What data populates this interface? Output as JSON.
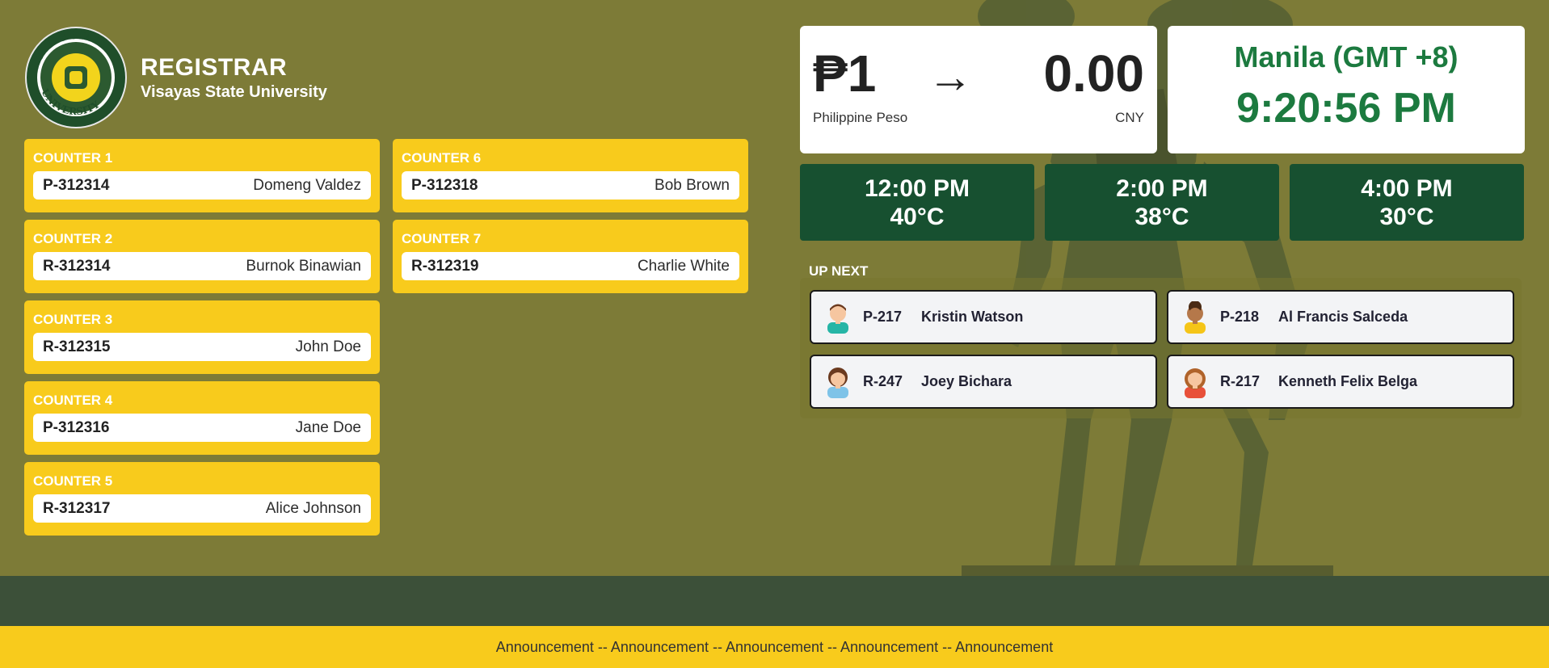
{
  "header": {
    "title": "REGISTRAR",
    "subtitle": "Visayas State University"
  },
  "counters": [
    {
      "label": "COUNTER 1",
      "ticket": "P-312314",
      "name": "Domeng Valdez"
    },
    {
      "label": "COUNTER 2",
      "ticket": "R-312314",
      "name": "Burnok Binawian"
    },
    {
      "label": "COUNTER 3",
      "ticket": "R-312315",
      "name": "John Doe"
    },
    {
      "label": "COUNTER 4",
      "ticket": "P-312316",
      "name": "Jane Doe"
    },
    {
      "label": "COUNTER 5",
      "ticket": "R-312317",
      "name": "Alice Johnson"
    },
    {
      "label": "COUNTER 6",
      "ticket": "P-312318",
      "name": "Bob Brown"
    },
    {
      "label": "COUNTER 7",
      "ticket": "R-312319",
      "name": "Charlie White"
    }
  ],
  "exchange": {
    "from_amount": "₱1",
    "arrow": "→",
    "to_amount": "0.00",
    "from_currency": "Philippine Peso",
    "to_currency": "CNY"
  },
  "clock": {
    "timezone": "Manila (GMT +8)",
    "time": "9:20:56 PM"
  },
  "forecast": [
    {
      "time": "12:00 PM",
      "temp": "40°C"
    },
    {
      "time": "2:00 PM",
      "temp": "38°C"
    },
    {
      "time": "4:00 PM",
      "temp": "30°C"
    }
  ],
  "up_next": {
    "label": "UP NEXT",
    "items": [
      {
        "ticket": "P-217",
        "name": "Kristin Watson",
        "avatar": "boy-avatar-icon"
      },
      {
        "ticket": "P-218",
        "name": "Al Francis Salceda",
        "avatar": "boy-avatar-icon"
      },
      {
        "ticket": "R-247",
        "name": "Joey Bichara",
        "avatar": "girl-avatar-icon"
      },
      {
        "ticket": "R-217",
        "name": "Kenneth Felix Belga",
        "avatar": "girl-avatar-icon"
      }
    ]
  },
  "seal_text": "VISAYAS STATE UNIVERSITY",
  "announcement": "Announcement -- Announcement -- Announcement -- Announcement -- Announcement",
  "colors": {
    "background": "#7d7b37",
    "accent_yellow": "#f8cb1c",
    "forecast_green": "#175030",
    "clock_green": "#1c7a3f"
  }
}
